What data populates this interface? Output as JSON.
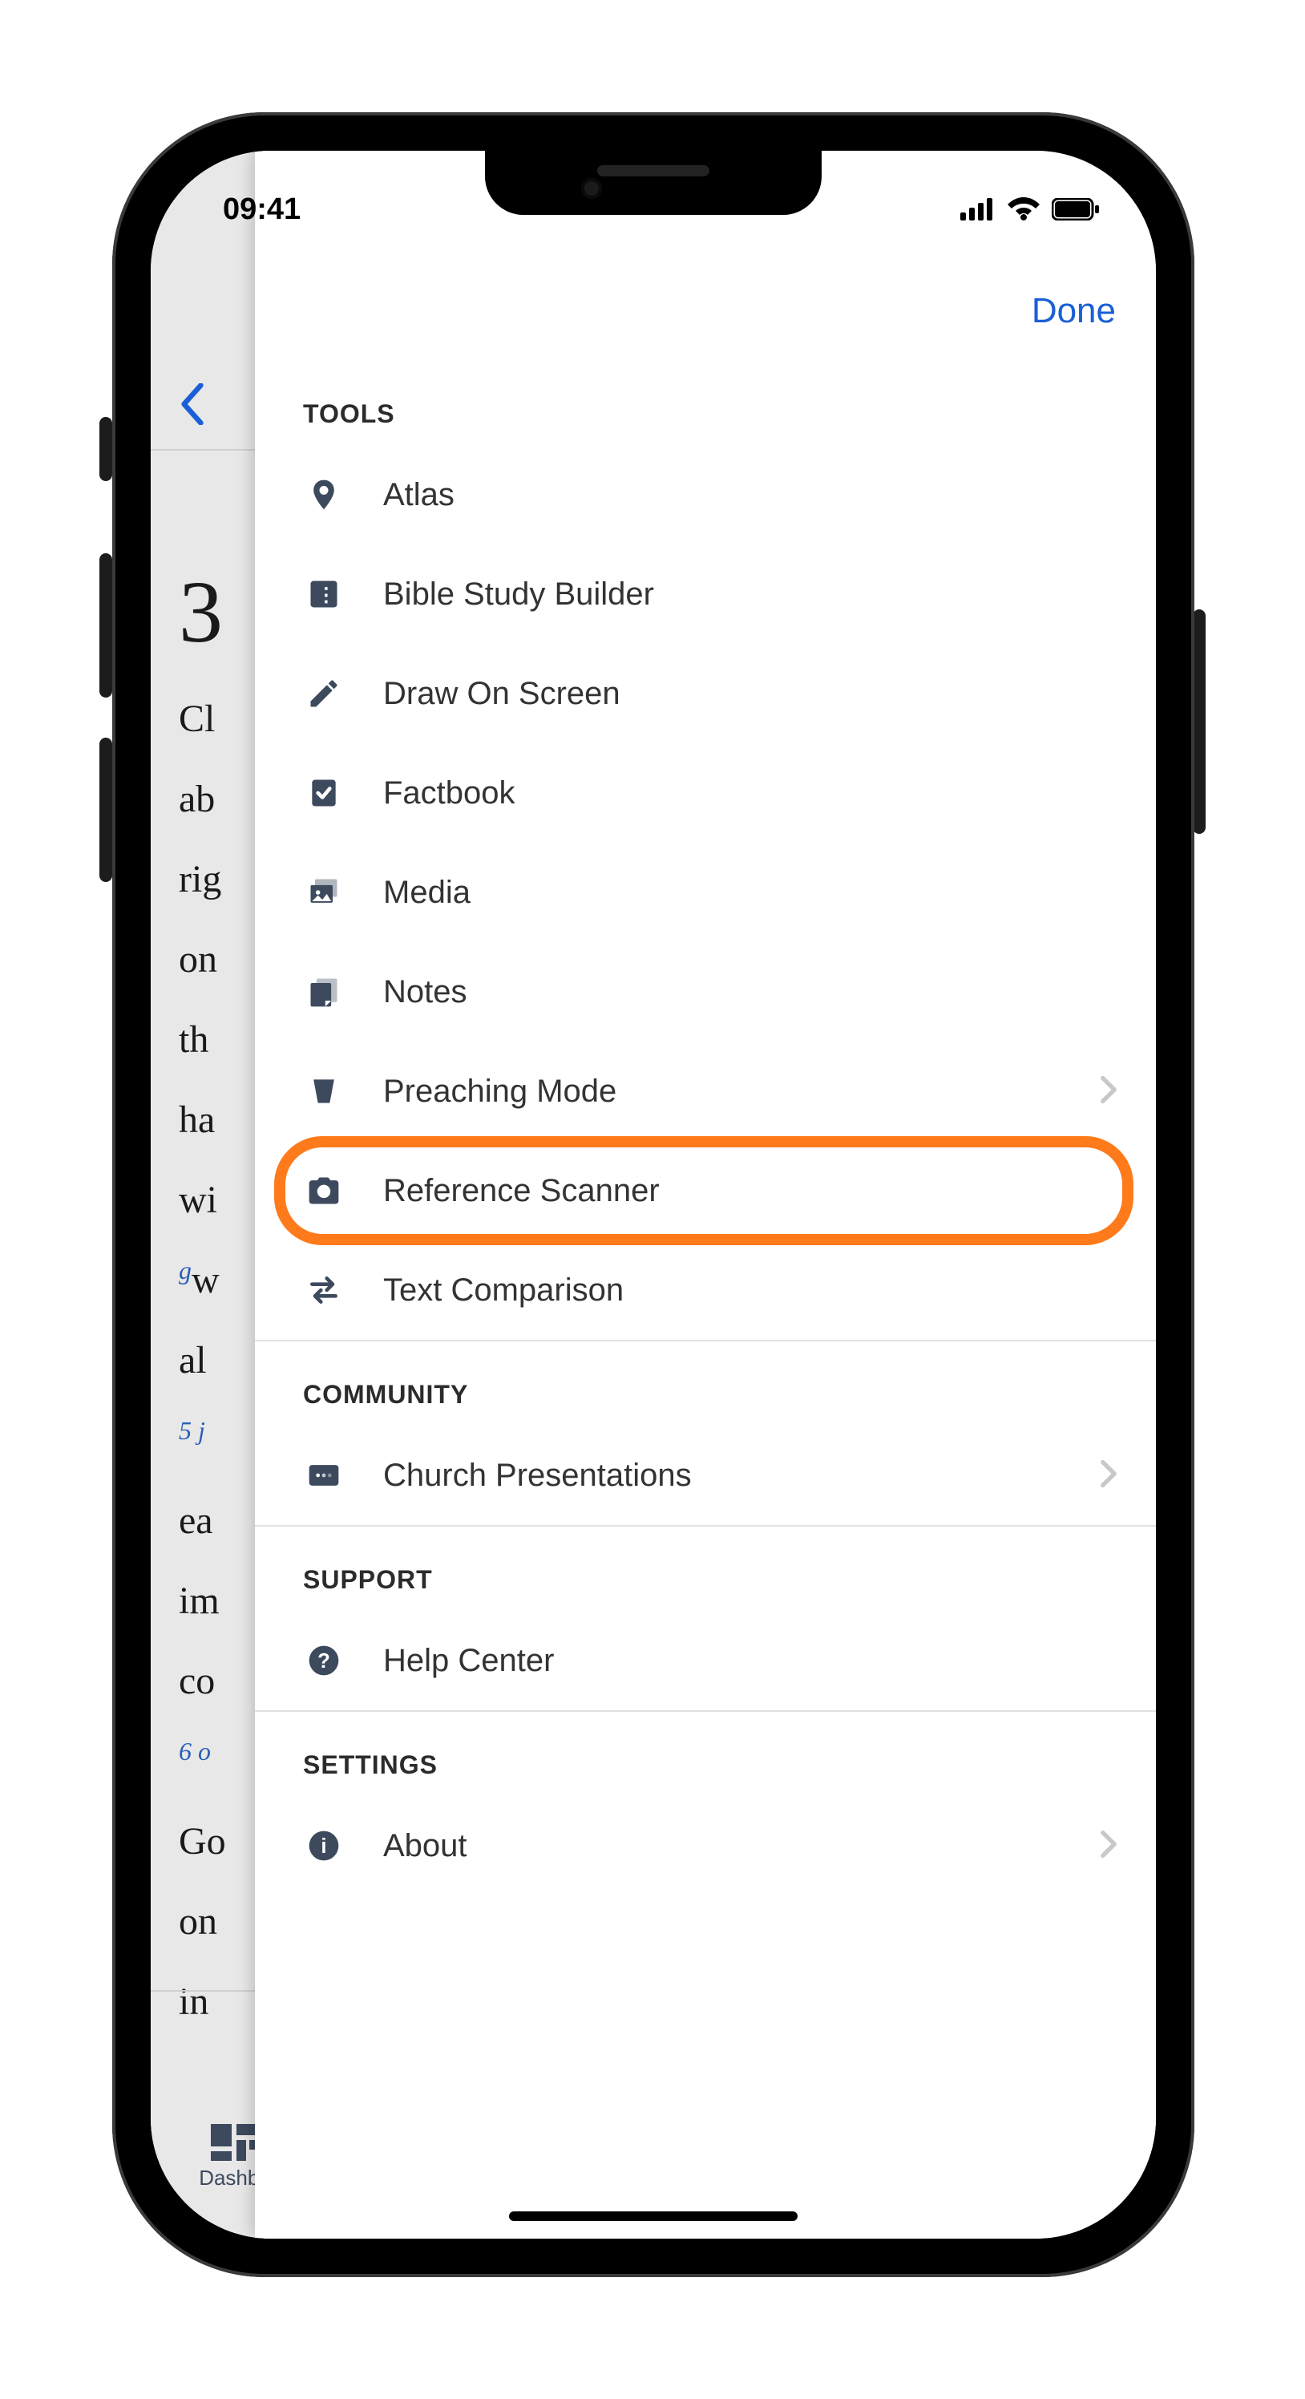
{
  "status": {
    "time": "09:41"
  },
  "drawer": {
    "done": "Done",
    "sections": {
      "tools": {
        "header": "TOOLS",
        "items": {
          "atlas": "Atlas",
          "bsb": "Bible Study Builder",
          "draw": "Draw On Screen",
          "factbook": "Factbook",
          "media": "Media",
          "notes": "Notes",
          "preaching": "Preaching Mode",
          "refscanner": "Reference Scanner",
          "textcomp": "Text Comparison"
        }
      },
      "community": {
        "header": "COMMUNITY",
        "items": {
          "church": "Church Presentations"
        }
      },
      "support": {
        "header": "SUPPORT",
        "items": {
          "help": "Help Center"
        }
      },
      "settings": {
        "header": "SETTINGS",
        "items": {
          "about": "About"
        }
      }
    }
  },
  "bg": {
    "chapter": "3",
    "lines": [
      "Cl",
      "ab",
      "rig",
      "on",
      "th",
      "ha",
      "wi",
      "w",
      "al",
      "",
      "ea",
      "im",
      "co",
      "o",
      "Go",
      "on",
      "in"
    ],
    "sup_g": "g",
    "sup_5j": "5 j",
    "sup_6o": "6 o",
    "dashboard": "Dashbo"
  }
}
